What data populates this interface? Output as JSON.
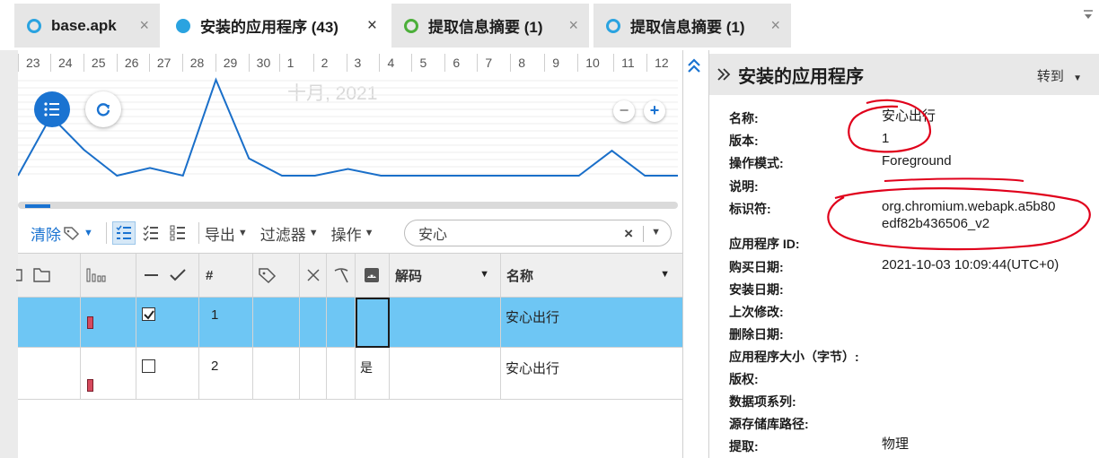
{
  "tabs": [
    {
      "label": "base.apk",
      "close": "×",
      "ring": "blue"
    },
    {
      "label": "安装的应用程序 (43)",
      "close": "×",
      "ring": "filled"
    },
    {
      "label": "提取信息摘要 (1)",
      "close": "×",
      "ring": "green"
    },
    {
      "label": "提取信息摘要 (1)",
      "close": "×",
      "ring": "blue"
    }
  ],
  "timeline": {
    "days": [
      "23",
      "24",
      "25",
      "26",
      "27",
      "28",
      "29",
      "30",
      "1",
      "2",
      "3",
      "4",
      "5",
      "6",
      "7",
      "8",
      "9",
      "10",
      "11",
      "12"
    ],
    "month": "十月, 2021",
    "activity": [
      0,
      0.62,
      0.27,
      0,
      0.08,
      0,
      1,
      0.18,
      0,
      0,
      0.07,
      0,
      0,
      0,
      0,
      0,
      0,
      0,
      0.26,
      0,
      0
    ],
    "line_color": "#1a6fc9"
  },
  "toolbar": {
    "clear": "清除",
    "export": "导出",
    "filter": "过滤器",
    "action": "操作",
    "search_value": "安心",
    "search_clear": "×"
  },
  "grid": {
    "headers": {
      "num": "#",
      "decode": "解码",
      "name": "名称"
    },
    "rows": [
      {
        "num": "1",
        "decode": "",
        "name": "安心出行",
        "checked": true,
        "selected": true
      },
      {
        "num": "2",
        "decode": "是",
        "name": "安心出行",
        "checked": false,
        "selected": false
      }
    ]
  },
  "details": {
    "title": "安装的应用程序",
    "goto": "转到",
    "props": [
      {
        "label": "名称:",
        "value": "安心出行"
      },
      {
        "label": "版本:",
        "value": "1"
      },
      {
        "label": "操作模式:",
        "value": "Foreground"
      },
      {
        "label": "说明:",
        "value": ""
      },
      {
        "label": "标识符:",
        "value": "org.chromium.webapk.a5b80",
        "value2": "edf82b436506_v2"
      },
      {
        "label": "应用程序 ID:",
        "value": ""
      },
      {
        "label": "购买日期:",
        "value": "2021-10-03 10:09:44(UTC+0)"
      },
      {
        "label": "安装日期:",
        "value": ""
      },
      {
        "label": "上次修改:",
        "value": ""
      },
      {
        "label": "删除日期:",
        "value": ""
      },
      {
        "label": "应用程序大小（字节）:",
        "value": ""
      },
      {
        "label": "版权:",
        "value": ""
      },
      {
        "label": "数据项系列:",
        "value": ""
      },
      {
        "label": "源存储库路径:",
        "value": ""
      },
      {
        "label": "提取:",
        "value": "物理"
      }
    ]
  },
  "colors": {
    "accent": "#1a73d1",
    "selected_row": "#6ec6f4",
    "annotation": "#e0001b"
  }
}
